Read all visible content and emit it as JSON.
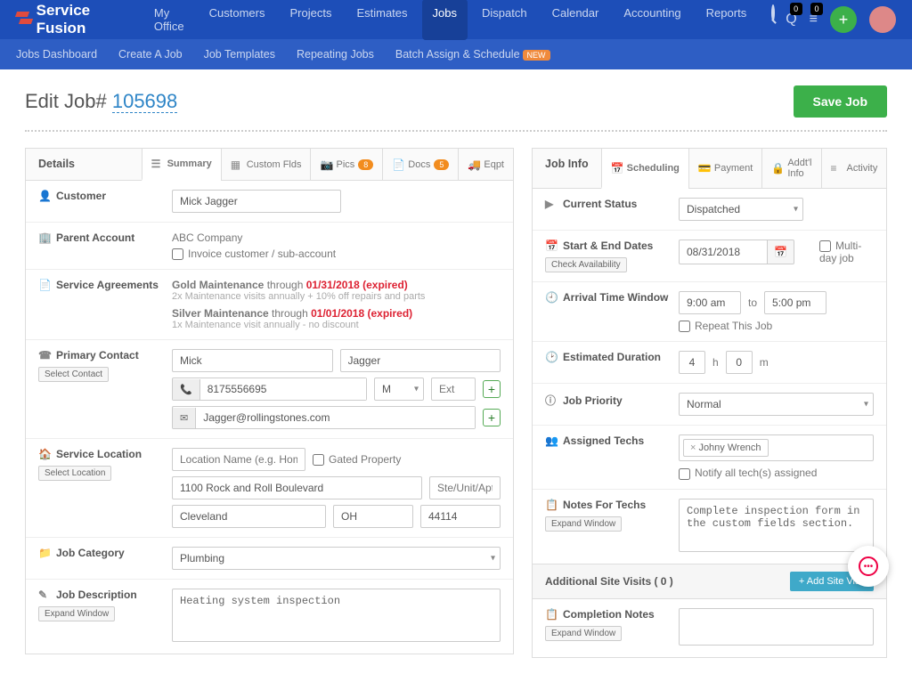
{
  "brand": "Service Fusion",
  "nav": [
    "My Office",
    "Customers",
    "Projects",
    "Estimates",
    "Jobs",
    "Dispatch",
    "Calendar",
    "Accounting",
    "Reports"
  ],
  "nav_active": "Jobs",
  "notif_count": "0",
  "queue_count": "0",
  "subnav": {
    "items": [
      "Jobs Dashboard",
      "Create A Job",
      "Job Templates",
      "Repeating Jobs",
      "Batch Assign & Schedule"
    ],
    "new_label": "NEW"
  },
  "page": {
    "title_prefix": "Edit Job# ",
    "job_number": "105698",
    "save_btn": "Save Job"
  },
  "details_panel": {
    "title": "Details",
    "tabs": {
      "summary": "Summary",
      "custom": "Custom Flds",
      "pics": "Pics",
      "pics_count": "8",
      "docs": "Docs",
      "docs_count": "5",
      "eqpt": "Eqpt"
    },
    "rows": {
      "customer_label": "Customer",
      "customer_value": "Mick Jagger",
      "parent_label": "Parent Account",
      "parent_value": "ABC Company",
      "invoice_sub_chk": "Invoice customer / sub-account",
      "sa_label": "Service Agreements",
      "sa1_name": "Gold Maintenance",
      "sa_through": " through ",
      "sa1_date": "01/31/2018 (expired)",
      "sa1_detail": "2x Maintenance visits annually + 10% off repairs and parts",
      "sa2_name": "Silver Maintenance",
      "sa2_date": "01/01/2018 (expired)",
      "sa2_detail": "1x Maintenance visit annually - no discount",
      "pc_label": "Primary Contact",
      "pc_select": "Select Contact",
      "pc_first": "Mick",
      "pc_last": "Jagger",
      "pc_phone": "8175556695",
      "pc_phone_type": "M",
      "pc_ext_ph": "Ext",
      "pc_email": "Jagger@rollingstones.com",
      "sl_label": "Service Location",
      "sl_select": "Select Location",
      "sl_name_ph": "Location Name (e.g. Home or Office)",
      "sl_gated": "Gated Property",
      "sl_addr1": "1100 Rock and Roll Boulevard",
      "sl_unit_ph": "Ste/Unit/Apt",
      "sl_city": "Cleveland",
      "sl_state": "OH",
      "sl_zip": "44114",
      "jc_label": "Job Category",
      "jc_value": "Plumbing",
      "jd_label": "Job Description",
      "jd_expand": "Expand Window",
      "jd_text": "Heating system inspection"
    }
  },
  "jobinfo_panel": {
    "title": "Job Info",
    "tabs": {
      "scheduling": "Scheduling",
      "payment": "Payment",
      "addtl": "Addt'l Info",
      "activity": "Activity"
    },
    "rows": {
      "status_label": "Current Status",
      "status_value": "Dispatched",
      "dates_label": "Start & End Dates",
      "check_avail": "Check Availability",
      "date_value": "08/31/2018",
      "multiday": "Multi-day job",
      "arrival_label": "Arrival Time Window",
      "arrival_from": "9:00 am",
      "arrival_to_word": "to",
      "arrival_to": "5:00 pm",
      "repeat_chk": "Repeat This Job",
      "dur_label": "Estimated Duration",
      "dur_h": "4",
      "dur_h_lbl": "h",
      "dur_m": "0",
      "dur_m_lbl": "m",
      "prio_label": "Job Priority",
      "prio_value": "Normal",
      "techs_label": "Assigned Techs",
      "tech_tag": "Johny Wrench",
      "notify_chk": "Notify all tech(s) assigned",
      "notes_label": "Notes For Techs",
      "notes_expand": "Expand Window",
      "notes_text": "Complete inspection form in the custom fields section."
    },
    "visits": {
      "title": "Additional Site Visits ( 0 )",
      "add_btn": "+ Add Site Visit"
    },
    "completion": {
      "label": "Completion Notes",
      "expand": "Expand Window"
    }
  }
}
